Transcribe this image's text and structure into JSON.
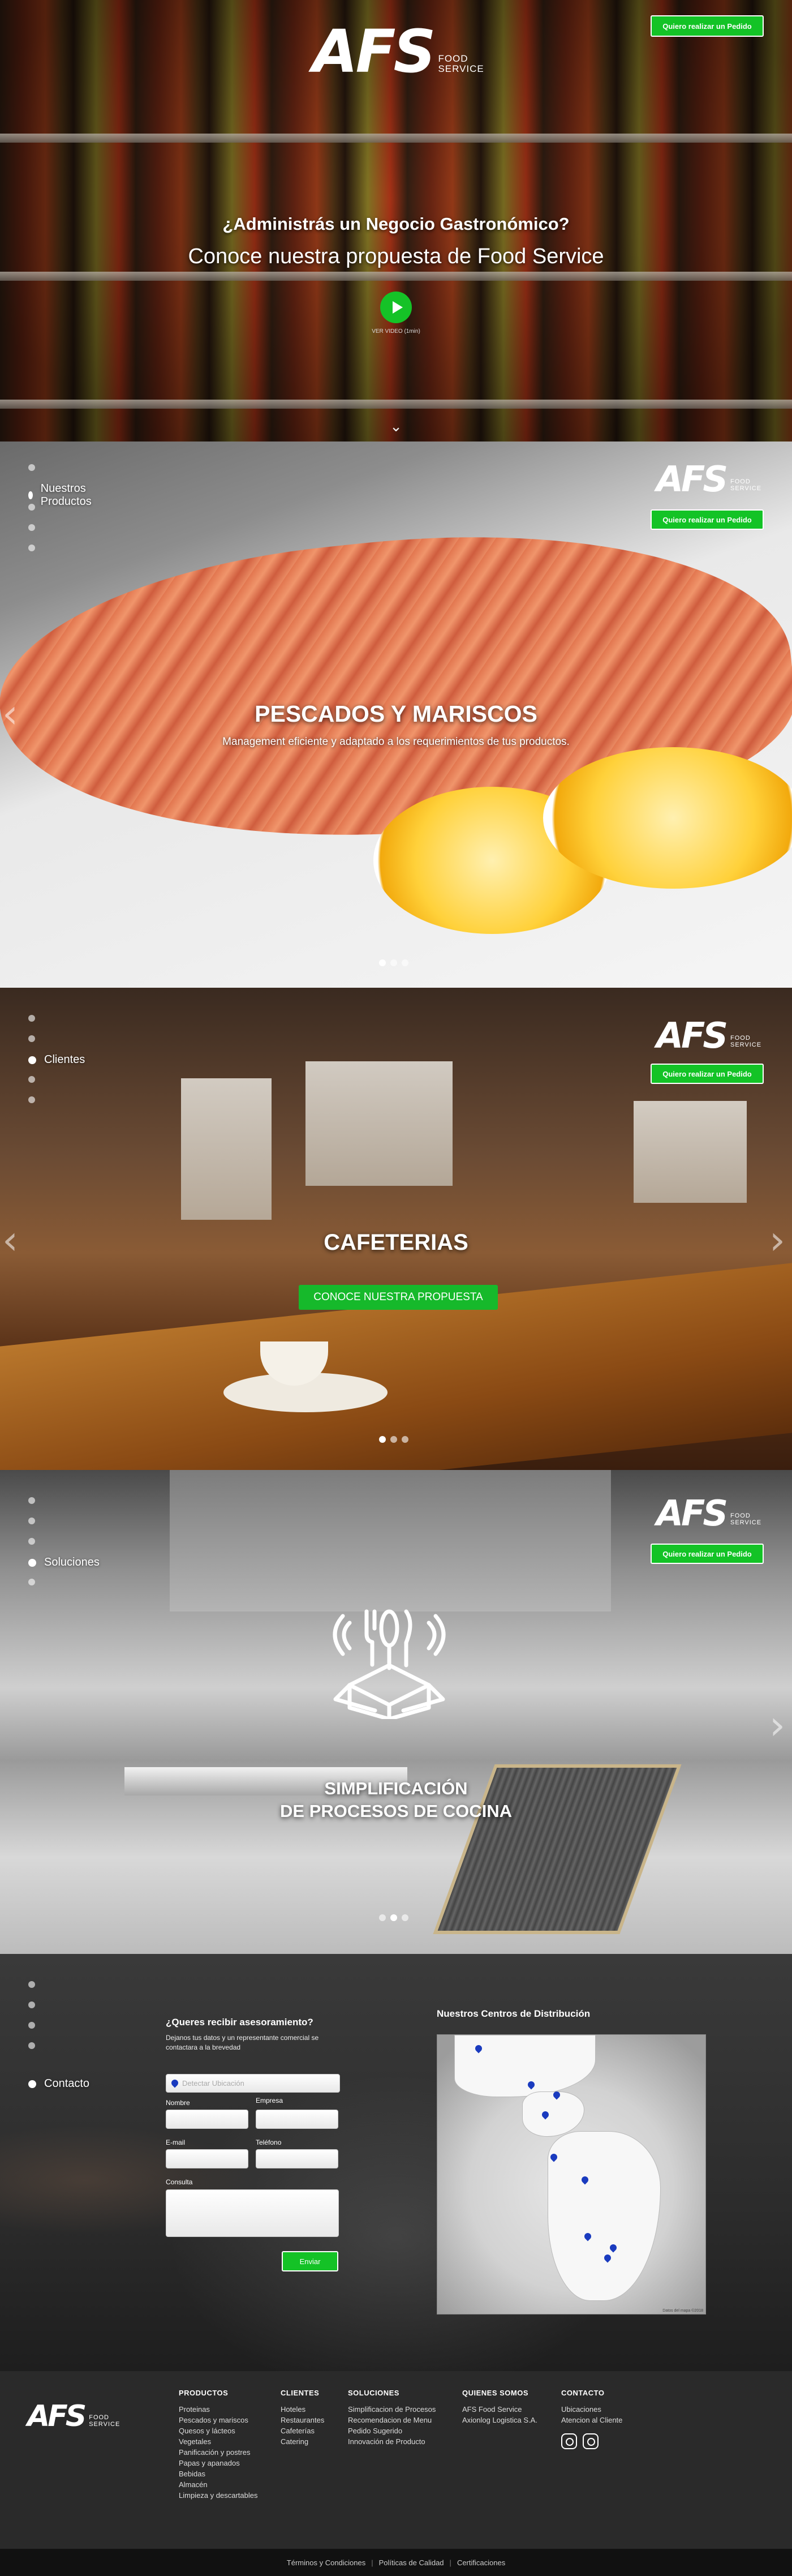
{
  "brand": {
    "logo_mark": "AFS",
    "logo_sub_1": "FOOD",
    "logo_sub_2": "SERVICE"
  },
  "header": {
    "order_button": "Quiero realizar un Pedido"
  },
  "hero": {
    "title": "¿Administrás un Negocio Gastronómico?",
    "subtitle": "Conoce nuestra propuesta de Food Service",
    "video_label": "VER VIDEO (1min)"
  },
  "products": {
    "nav_label": "Nuestros Productos",
    "title": "PESCADOS Y MARISCOS",
    "subtitle": "Management eficiente y adaptado a los requerimientos de tus productos."
  },
  "clients": {
    "nav_label": "Clientes",
    "title": "CAFETERIAS",
    "cta": "CONOCE NUESTRA PROPUESTA"
  },
  "solutions": {
    "nav_label": "Soluciones",
    "title_line_1": "SIMPLIFICACIÓN",
    "title_line_2": "DE PROCESOS DE COCINA"
  },
  "contact": {
    "nav_label": "Contacto",
    "form_title": "¿Queres recibir asesoramiento?",
    "form_desc": "Dejanos tus datos y un representante comercial se contactara a la brevedad",
    "location_placeholder": "Detectar Ubicación",
    "name_label": "Nombre",
    "company_label": "Empresa",
    "email_label": "E-mail",
    "phone_label": "Teléfono",
    "query_label": "Consulta",
    "send_button": "Enviar",
    "map_title": "Nuestros Centros de Distribución",
    "map_credit": "Datos del mapa ©2018"
  },
  "footer": {
    "columns": [
      {
        "title": "PRODUCTOS",
        "links": [
          "Proteinas",
          "Pescados y mariscos",
          "Quesos y lácteos",
          "Vegetales",
          "Panificación y postres",
          "Papas y apanados",
          "Bebidas",
          "Almacén",
          "Limpieza y descartables"
        ]
      },
      {
        "title": "CLIENTES",
        "links": [
          "Hoteles",
          "Restaurantes",
          "Cafeterías",
          "Catering"
        ]
      },
      {
        "title": "SOLUCIONES",
        "links": [
          "Simplificacion de Procesos",
          "Recomendacion de Menu",
          "Pedido Sugerido",
          "Innovación de Producto"
        ]
      },
      {
        "title": "QUIENES SOMOS",
        "links": [
          "AFS Food Service",
          "Axionlog Logistica S.A."
        ]
      },
      {
        "title": "CONTACTO",
        "links": [
          "Ubicaciones",
          "Atencion al Cliente"
        ]
      }
    ]
  },
  "legal": {
    "terms": "Términos y Condiciones",
    "quality": "Políticas de Calidad",
    "certs": "Certificaciones"
  },
  "colors": {
    "accent_green": "#13c326"
  }
}
